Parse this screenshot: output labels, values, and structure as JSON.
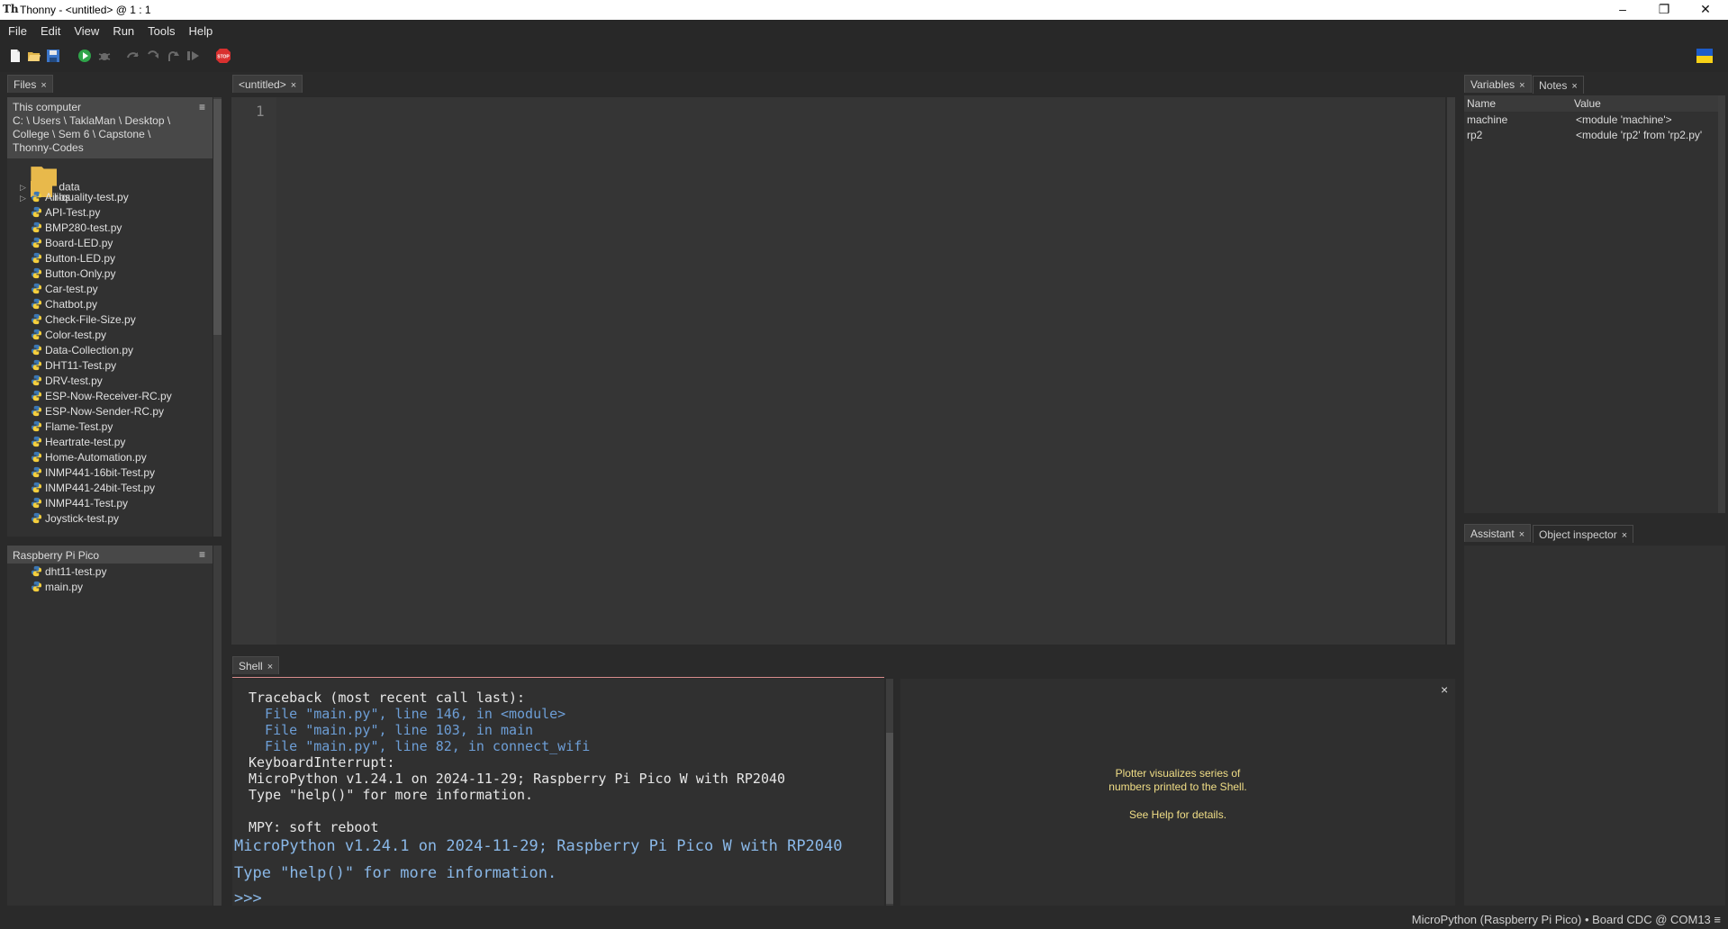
{
  "window": {
    "title": "Thonny  -  <untitled>  @  1 : 1",
    "app_icon": "Th",
    "minimize": "–",
    "restore": "❐",
    "close": "✕"
  },
  "menu": [
    "File",
    "Edit",
    "View",
    "Run",
    "Tools",
    "Help"
  ],
  "toolbar": {
    "icons": [
      "new-file-icon",
      "open-file-icon",
      "save-icon",
      "run-icon",
      "debug-icon",
      "step-over-icon",
      "step-into-icon",
      "step-out-icon",
      "resume-icon",
      "stop-icon",
      "ukraine-flag-icon"
    ],
    "stop_label": "STOP"
  },
  "files_panel": {
    "tab": "Files",
    "local_header": "This computer",
    "local_path": [
      "C: \\ Users \\ TaklaMan \\ Desktop \\",
      "College \\ Sem 6 \\ Capstone \\",
      "Thonny-Codes"
    ],
    "folders": [
      "data",
      "libs"
    ],
    "files": [
      "Air-quality-test.py",
      "API-Test.py",
      "BMP280-test.py",
      "Board-LED.py",
      "Button-LED.py",
      "Button-Only.py",
      "Car-test.py",
      "Chatbot.py",
      "Check-File-Size.py",
      "Color-test.py",
      "Data-Collection.py",
      "DHT11-Test.py",
      "DRV-test.py",
      "ESP-Now-Receiver-RC.py",
      "ESP-Now-Sender-RC.py",
      "Flame-Test.py",
      "Heartrate-test.py",
      "Home-Automation.py",
      "INMP441-16bit-Test.py",
      "INMP441-24bit-Test.py",
      "INMP441-Test.py",
      "Joystick-test.py"
    ],
    "device_header": "Raspberry Pi Pico",
    "device_files": [
      "dht11-test.py",
      "main.py"
    ],
    "menu_glyph": "≡"
  },
  "editor": {
    "tab": "<untitled>",
    "line_number": "1"
  },
  "shell": {
    "tab": "Shell",
    "lines": [
      {
        "text": "Traceback (most recent call last):",
        "style": "normal"
      },
      {
        "text": "  File \"main.py\", line 146, in <module>",
        "style": "blue"
      },
      {
        "text": "  File \"main.py\", line 103, in main",
        "style": "blue"
      },
      {
        "text": "  File \"main.py\", line 82, in connect_wifi",
        "style": "blue"
      },
      {
        "text": "KeyboardInterrupt:",
        "style": "normal"
      },
      {
        "text": "MicroPython v1.24.1 on 2024-11-29; Raspberry Pi Pico W with RP2040",
        "style": "normal"
      },
      {
        "text": "Type \"help()\" for more information.",
        "style": "normal"
      },
      {
        "text": "",
        "style": "normal"
      },
      {
        "text": "MPY: soft reboot",
        "style": "normal"
      }
    ],
    "banner_1": "MicroPython v1.24.1 on 2024-11-29; Raspberry Pi Pico W with RP2040",
    "banner_2": "Type \"help()\" for more information.",
    "prompt": ">>>"
  },
  "plotter": {
    "line1": "Plotter visualizes series of",
    "line2": "numbers printed to the Shell.",
    "line3": "See Help for details.",
    "close": "×"
  },
  "variables_panel": {
    "tabs": [
      "Variables",
      "Notes"
    ],
    "columns": [
      "Name",
      "Value"
    ],
    "rows": [
      {
        "name": "machine",
        "value": "<module 'machine'>"
      },
      {
        "name": "rp2",
        "value": "<module 'rp2' from 'rp2.py'"
      }
    ]
  },
  "assistant_panel": {
    "tabs": [
      "Assistant",
      "Object inspector"
    ]
  },
  "status_bar": {
    "interpreter": "MicroPython (Raspberry Pi Pico)  •  Board CDC @ COM13  ≡"
  },
  "tab_close_glyph": "×"
}
